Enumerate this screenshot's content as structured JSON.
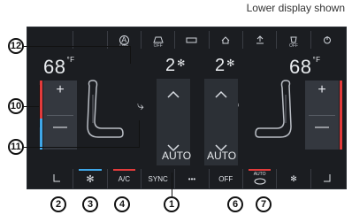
{
  "caption": "Lower display shown",
  "left": {
    "temp": "68",
    "unit": "°F",
    "plus": "+",
    "minus": "—"
  },
  "right": {
    "temp": "68",
    "unit": "°F",
    "plus": "+",
    "minus": "—"
  },
  "fan": {
    "left": "2",
    "right": "2"
  },
  "auto": {
    "left": "AUTO",
    "right": "AUTO"
  },
  "top_buttons": [
    {
      "icon": "auto-off-icon",
      "sub": "OFF"
    },
    {
      "icon": "windshield-icon",
      "sub": "OFF"
    },
    {
      "icon": "rear-defrost-icon",
      "sub": ""
    },
    {
      "icon": "home-icon",
      "sub": ""
    },
    {
      "icon": "upload-icon",
      "sub": ""
    },
    {
      "icon": "air-quality-icon",
      "sub": "OFF"
    },
    {
      "icon": "power-icon",
      "sub": ""
    }
  ],
  "bottom_buttons": [
    {
      "label": "",
      "icon": "seat-heat-left-icon"
    },
    {
      "label": "",
      "icon": "fan-icon"
    },
    {
      "label": "A/C",
      "icon": ""
    },
    {
      "label": "SYNC",
      "icon": ""
    },
    {
      "label": "•••",
      "icon": ""
    },
    {
      "label": "OFF",
      "icon": ""
    },
    {
      "label": "AUTO",
      "icon": "auto-climate-icon"
    },
    {
      "label": "",
      "icon": "seat-fan-right-icon"
    },
    {
      "label": "",
      "icon": "seat-heat-right-icon"
    }
  ],
  "callouts": [
    "12",
    "10",
    "11",
    "2",
    "3",
    "4",
    "1",
    "6",
    "7"
  ],
  "colors": {
    "heat": "#e23b3b",
    "cool": "#3fa7e8"
  }
}
